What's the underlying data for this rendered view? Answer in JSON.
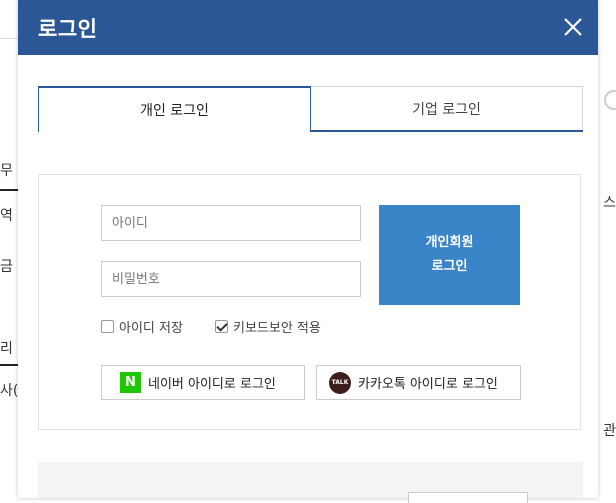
{
  "background": {
    "left_texts": [
      "무",
      "역",
      "금",
      "리",
      "사("
    ],
    "right_texts": [
      "스",
      "관"
    ]
  },
  "modal": {
    "title": "로그인",
    "header_color": "#2b5796",
    "tabs": [
      {
        "label": "개인 로그인",
        "active": true
      },
      {
        "label": "기업 로그인",
        "active": false
      }
    ],
    "form": {
      "id_placeholder": "아이디",
      "password_placeholder": "비밀번호",
      "login_button": {
        "line1": "개인회원",
        "line2": "로그인"
      },
      "save_id": {
        "label": "아이디 저장",
        "checked": false
      },
      "keyboard_security": {
        "label": "키보드보안 적용",
        "checked": true
      }
    },
    "social": {
      "naver": {
        "logo": "N",
        "label": "네이버 아이디로 로그인"
      },
      "kakao": {
        "logo": "TALK",
        "label": "카카오톡 아이디로 로그인"
      }
    },
    "accent_color": "#3a84c8"
  }
}
